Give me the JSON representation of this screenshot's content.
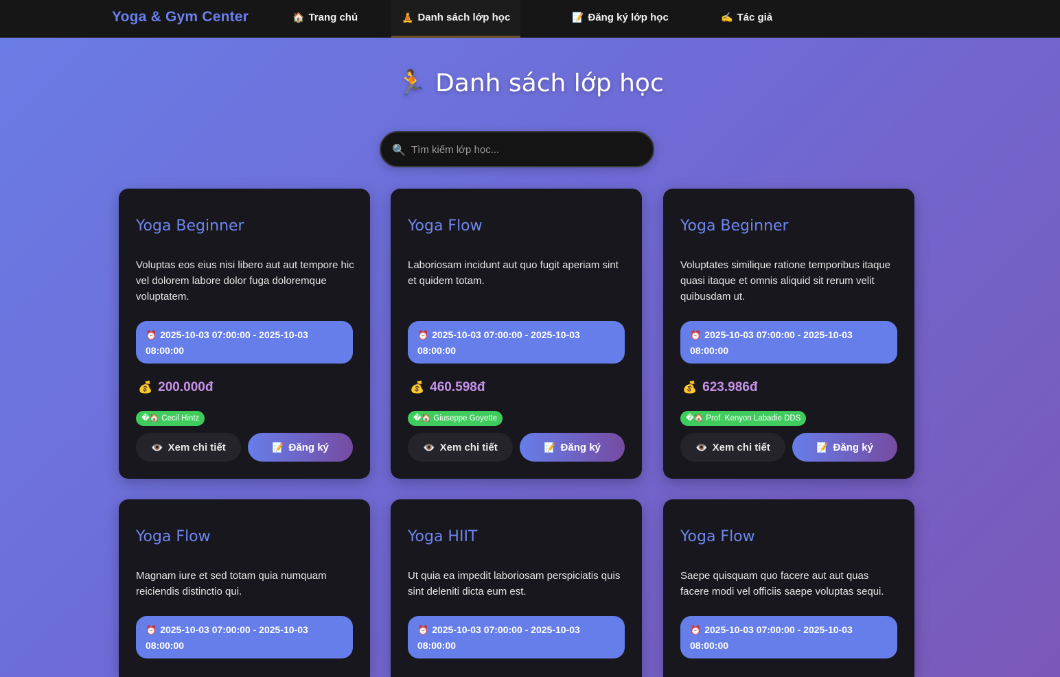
{
  "nav": {
    "brand": "Yoga & Gym Center",
    "links": [
      {
        "icon": "🏠",
        "label": "Trang chủ"
      },
      {
        "icon": "🧘",
        "label": "Danh sách lớp học"
      },
      {
        "icon": "📝",
        "label": "Đăng ký lớp học"
      },
      {
        "icon": "✍️",
        "label": "Tác giả"
      }
    ]
  },
  "header": {
    "icon": "🏃",
    "title": "Danh sách lớp học"
  },
  "search": {
    "icon": "🔍",
    "placeholder": "Tìm kiếm lớp học..."
  },
  "buttons": {
    "detail_icon": "👁️",
    "detail_label": "Xem chi tiết",
    "register_icon": "📝",
    "register_label": "Đăng ký"
  },
  "time_icon": "⏰",
  "price_icon": "💰",
  "classes": [
    {
      "title": "Yoga Beginner",
      "description": "Voluptas eos eius nisi libero aut aut tempore hic vel dolorem labore dolor fuga doloremque voluptatem.",
      "time": "2025-10-03 07:00:00 - 2025-10-03 08:00:00",
      "price": "200.000đ",
      "trainer": "�🏠 Cecil Hintz"
    },
    {
      "title": "Yoga Flow",
      "description": "Laboriosam incidunt aut quo fugit aperiam sint et quidem totam.",
      "time": "2025-10-03 07:00:00 - 2025-10-03 08:00:00",
      "price": "460.598đ",
      "trainer": "�🏠 Giuseppe Goyette"
    },
    {
      "title": "Yoga Beginner",
      "description": "Voluptates similique ratione temporibus itaque quasi itaque et omnis aliquid sit rerum velit quibusdam ut.",
      "time": "2025-10-03 07:00:00 - 2025-10-03 08:00:00",
      "price": "623.986đ",
      "trainer": "�🏠 Prof. Kenyon Labadie DDS"
    },
    {
      "title": "Yoga Flow",
      "description": "Magnam iure et sed totam quia numquam reiciendis distinctio qui.",
      "time": "2025-10-03 07:00:00 - 2025-10-03 08:00:00"
    },
    {
      "title": "Yoga HIIT",
      "description": "Ut quia ea impedit laboriosam perspiciatis quis sint deleniti dicta eum est.",
      "time": "2025-10-03 07:00:00 - 2025-10-03 08:00:00"
    },
    {
      "title": "Yoga Flow",
      "description": "Saepe quisquam quo facere aut aut quas facere modi vel officiis saepe voluptas sequi.",
      "time": "2025-10-03 07:00:00 - 2025-10-03 08:00:00"
    }
  ]
}
